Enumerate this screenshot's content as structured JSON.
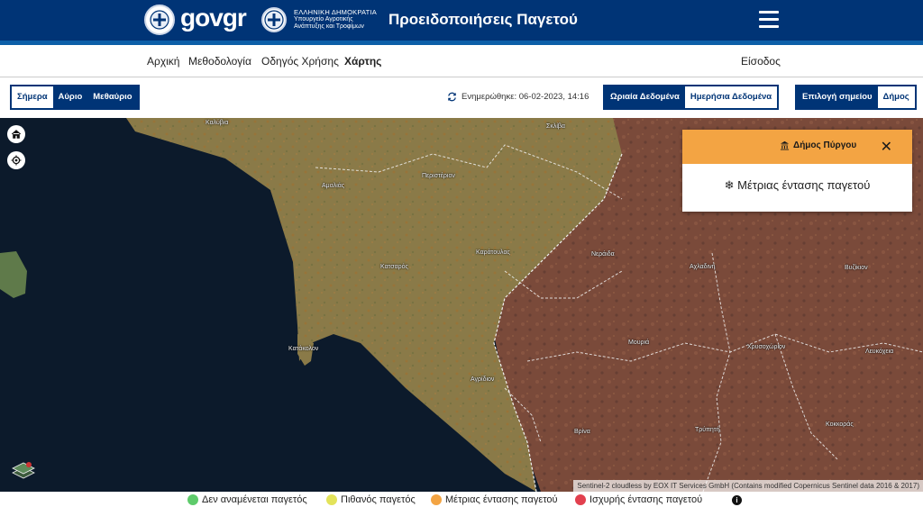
{
  "header": {
    "brand_gov": "gov",
    "brand_gr": "gr",
    "republic": "ΕΛΛΗΝΙΚΗ ΔΗΜΟΚΡΑΤΙΑ",
    "ministry": "Υπουργείο Αγροτικής Ανάπτυξης και Τροφίμων",
    "app_title": "Προειδοποιήσεις Παγετού",
    "menu_icon": "hamburger-menu-icon",
    "bg_color": "#003476"
  },
  "nav": {
    "items": [
      {
        "label": "Αρχική"
      },
      {
        "label": "Μεθοδολογία"
      },
      {
        "label": "Οδηγός Χρήσης"
      },
      {
        "label": "Χάρτης",
        "active": true
      }
    ],
    "login": "Είσοδος"
  },
  "toolbar": {
    "days": [
      {
        "label": "Σήμερα",
        "selected": true
      },
      {
        "label": "Αύριο"
      },
      {
        "label": "Μεθαύριο"
      }
    ],
    "updated": "Ενημερώθηκε: 06-02-2023, 14:16",
    "data_modes": [
      {
        "label": "Ωριαία Δεδομένα"
      },
      {
        "label": "Ημερήσια Δεδομένα",
        "selected": true
      }
    ],
    "selection_modes": [
      {
        "label": "Επιλογή σημείου"
      },
      {
        "label": "Δήμος",
        "selected": true
      }
    ]
  },
  "map": {
    "places": [
      "Καλύβια",
      "Σκλίβα",
      "Αμαλιάς",
      "Περιστέριον",
      "Κατσαρός",
      "Καράτουλας",
      "Νεράιδα",
      "Αχλαδινή",
      "Βυζίκιον",
      "Κατάκολον",
      "Μουριά",
      "Χρυσοχώριον",
      "Λευκόχεια",
      "Αγρίδιον",
      "Τρύπητή",
      "Κοκκοράς",
      "Βρίνα"
    ],
    "attribution": "Sentinel-2 cloudless by EOX IT Services GmbH (Contains modified Copernicus Sentinel data 2016 & 2017)",
    "controls": [
      "home-icon",
      "locate-icon",
      "layers-icon"
    ],
    "popup": {
      "title": "Δήμος Πύργου",
      "title_icon": "municipality-building-icon",
      "message": "❄ Μέτριας έντασης παγετού",
      "header_color": "#f3a443"
    }
  },
  "legend": [
    {
      "label": "Δεν αναμένεται παγετός",
      "color": "#5ecb6b"
    },
    {
      "label": "Πιθανός παγετός",
      "color": "#e3e35a"
    },
    {
      "label": "Μέτριας έντασης παγετού",
      "color": "#f3a443"
    },
    {
      "label": "Ισχυρής έντασης παγετού",
      "color": "#e2404e"
    }
  ]
}
